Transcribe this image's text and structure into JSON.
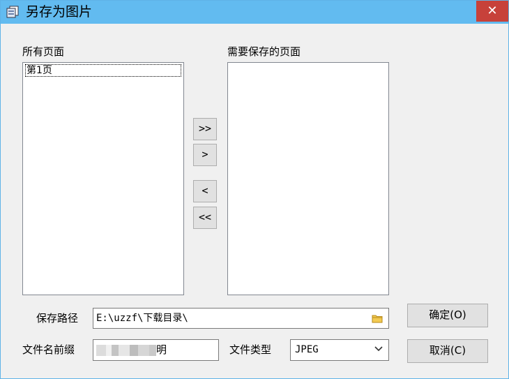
{
  "window": {
    "title": "另存为图片",
    "close_glyph": "✕"
  },
  "left_list": {
    "label": "所有页面",
    "items": [
      "第1页"
    ]
  },
  "right_list": {
    "label": "需要保存的页面"
  },
  "arrows": {
    "add_all": ">>",
    "add": ">",
    "remove": "<",
    "remove_all": "<<"
  },
  "save_path": {
    "label": "保存路径",
    "value": "E:\\uzzf\\下载目录\\"
  },
  "filename_prefix": {
    "label": "文件名前缀",
    "value_visible_tail": "明"
  },
  "file_type": {
    "label": "文件类型",
    "selected": "JPEG"
  },
  "buttons": {
    "ok": "确定(O)",
    "cancel": "取消(C)"
  },
  "colors": {
    "titlebar": "#62bbf0",
    "close": "#c7413a",
    "folder": "#e8b52a"
  }
}
